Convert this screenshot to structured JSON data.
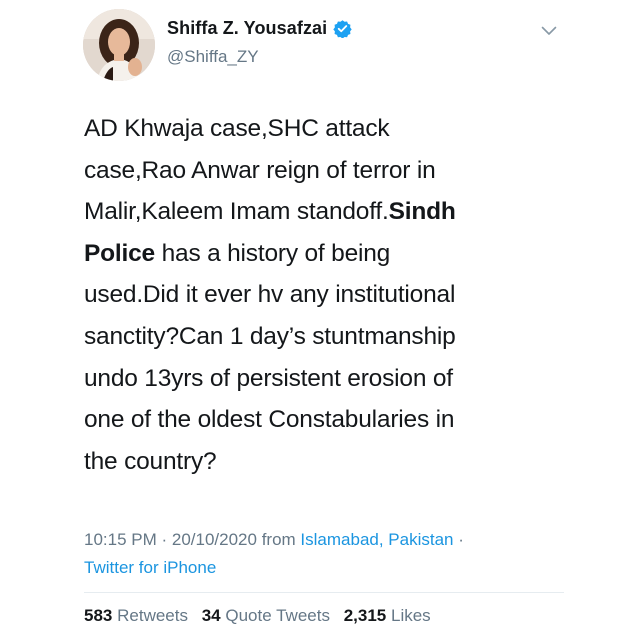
{
  "user": {
    "display_name": "Shiffa Z. Yousafzai",
    "handle": "@Shiffa_ZY",
    "verified_icon": "verified-badge-icon"
  },
  "menu_icon": "chevron-down-icon",
  "tweet": {
    "lines": [
      [
        {
          "text": "AD Khwaja case,SHC attack",
          "bold": false
        }
      ],
      [
        {
          "text": "case,Rao Anwar reign of terror in",
          "bold": false
        }
      ],
      [
        {
          "text": "Malir,Kaleem Imam standoff.",
          "bold": false
        },
        {
          "text": "Sindh",
          "bold": true
        }
      ],
      [
        {
          "text": "Police",
          "bold": true
        },
        {
          "text": " has a history of being",
          "bold": false
        }
      ],
      [
        {
          "text": "used.Did it ever hv any institutional",
          "bold": false
        }
      ],
      [
        {
          "text": "sanctity?Can 1 day’s stuntmanship",
          "bold": false
        }
      ],
      [
        {
          "text": "undo 13yrs of persistent erosion of",
          "bold": false
        }
      ],
      [
        {
          "text": "one of the oldest Constabularies in",
          "bold": false
        }
      ],
      [
        {
          "text": "the country?",
          "bold": false
        }
      ]
    ]
  },
  "meta": {
    "time": "10:15 PM",
    "separator": " · ",
    "date": "20/10/2020",
    "from_label": " from ",
    "location": "Islamabad, Pakistan",
    "trailing_separator": " ·",
    "source": "Twitter for iPhone"
  },
  "stats": {
    "retweets_count": "583",
    "retweets_label": "Retweets",
    "quotes_count": "34",
    "quotes_label": "Quote Tweets",
    "likes_count": "2,315",
    "likes_label": "Likes"
  },
  "colors": {
    "link": "#1b95e0",
    "secondary_text": "#657786",
    "primary_text": "#14171a",
    "verified": "#1da1f2"
  }
}
